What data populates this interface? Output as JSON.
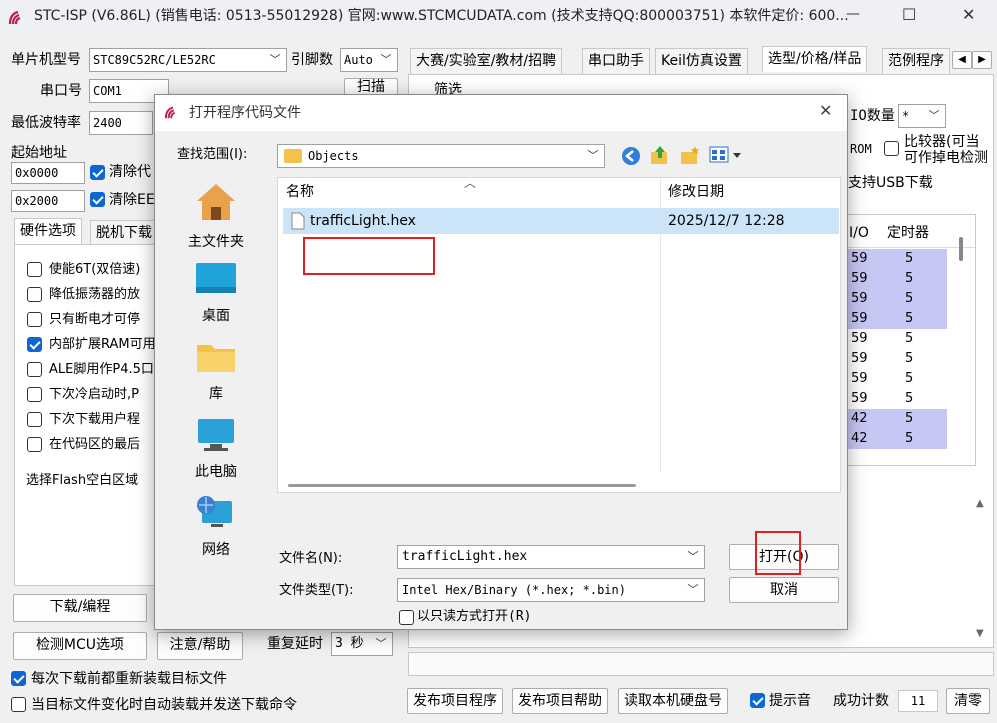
{
  "window": {
    "title": "STC-ISP (V6.86L) (销售电话: 0513-55012928) 官网:www.STCMCUDATA.com  (技术支持QQ:800003751) 本软件定价: 600...",
    "minimize": "—",
    "maximize": "☐",
    "close": "✕"
  },
  "left": {
    "mcu_label": "单片机型号",
    "mcu_value": "STC89C52RC/LE52RC",
    "pin_label": "引脚数",
    "pin_value": "Auto",
    "port_label": "串口号",
    "port_value": "COM1",
    "scan_button": "扫描",
    "baud_label": "最低波特率",
    "baud_value": "2400",
    "start_addr_label": "起始地址",
    "addr1": "0x0000",
    "clear1": "清除代",
    "addr2": "0x2000",
    "clear2": "清除EE",
    "tab_hw": "硬件选项",
    "tab_offline": "脱机下载",
    "options": [
      {
        "label": "使能6T(双倍速)",
        "checked": false
      },
      {
        "label": "降低振荡器的放",
        "checked": false
      },
      {
        "label": "只有断电才可停",
        "checked": false
      },
      {
        "label": "内部扩展RAM可用",
        "checked": true
      },
      {
        "label": "ALE脚用作P4.5口",
        "checked": false
      },
      {
        "label": "下次冷启动时,P",
        "checked": false
      },
      {
        "label": "下次下载用户程",
        "checked": false
      },
      {
        "label": "在代码区的最后",
        "checked": false
      }
    ],
    "flash_fill": "选择Flash空白区域",
    "download_button": "下载/编程",
    "detect_button": "检测MCU选项",
    "help_button": "注意/帮助",
    "repeat_delay_label": "重复延时",
    "repeat_delay_value": "3 秒",
    "reload_label": "每次下载前都重新装载目标文件",
    "auto_label": "当目标文件变化时自动装载并发送下载命令"
  },
  "right": {
    "tabs": [
      "大赛/实验室/教材/招聘",
      "串口助手",
      "Keil仿真设置",
      "选型/价格/样品",
      "范例程序"
    ],
    "filter_label": "筛选",
    "io_count_label": "IO数量",
    "io_count_value": "*",
    "comparator_label": "比较器(可当",
    "comparator_label2": "可作掉电检测",
    "rom_label": "ROM",
    "usb_label": "支持USB下载",
    "col_io": "I/O",
    "col_timer": "定时器",
    "rows": [
      {
        "io": "59",
        "timer": "5",
        "hl": true
      },
      {
        "io": "59",
        "timer": "5",
        "hl": true
      },
      {
        "io": "59",
        "timer": "5",
        "hl": true
      },
      {
        "io": "59",
        "timer": "5",
        "hl": true
      },
      {
        "io": "59",
        "timer": "5",
        "hl": false
      },
      {
        "io": "59",
        "timer": "5",
        "hl": false
      },
      {
        "io": "59",
        "timer": "5",
        "hl": false
      },
      {
        "io": "59",
        "timer": "5",
        "hl": false
      },
      {
        "io": "42",
        "timer": "5",
        "hl": true
      },
      {
        "io": "42",
        "timer": "5",
        "hl": true
      }
    ],
    "publish_program": "发布项目程序",
    "publish_help": "发布项目帮助",
    "read_disk": "读取本机硬盘号",
    "sound_label": "提示音",
    "success_label": "成功计数",
    "success_value": "11",
    "clear_button": "清零"
  },
  "dialog": {
    "title": "打开程序代码文件",
    "lookin_label": "查找范围(I):",
    "lookin_value": "Objects",
    "places": [
      "主文件夹",
      "桌面",
      "库",
      "此电脑",
      "网络"
    ],
    "col_name": "名称",
    "col_date": "修改日期",
    "file_name": "trafficLight.hex",
    "file_date": "2025/12/7 12:28",
    "filename_label": "文件名(N):",
    "filename_value": "trafficLight.hex",
    "filetype_label": "文件类型(T):",
    "filetype_value": "Intel Hex/Binary (*.hex; *.bin)",
    "readonly_label": "以只读方式打开(R)",
    "open_button": "打开(O)",
    "cancel_button": "取消"
  },
  "colors": {
    "highlight_row": "#c7c7f5",
    "selected_file": "#cce4f7",
    "red_marker": "#e02020",
    "accent": "#0a67d4"
  }
}
